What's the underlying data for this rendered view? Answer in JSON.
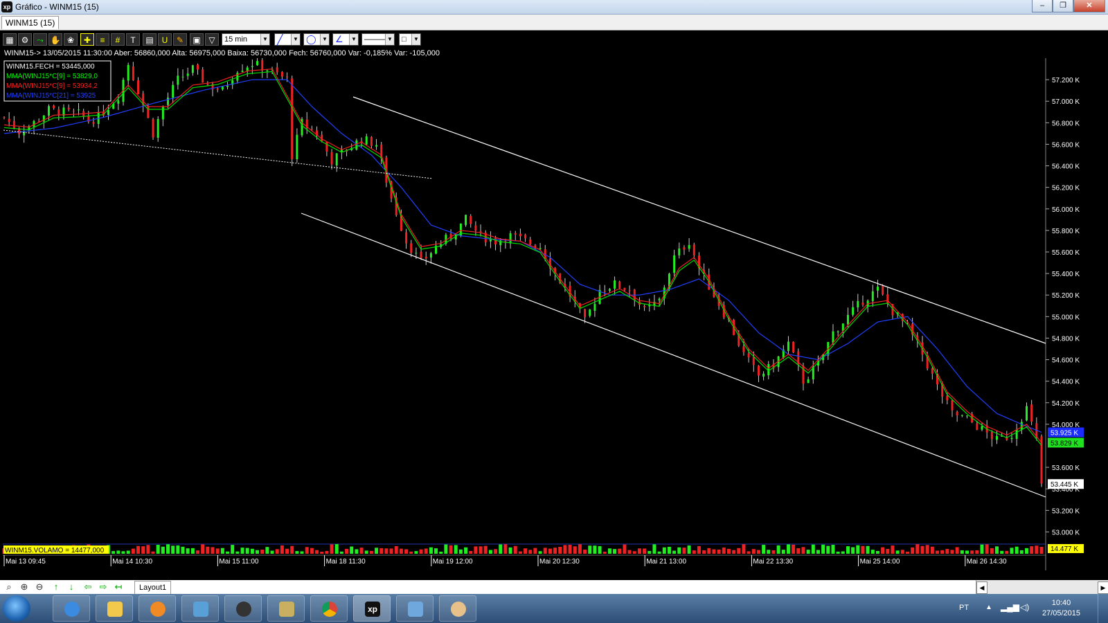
{
  "window": {
    "title": "Gráfico - WINM15 (15)",
    "app_icon": "xp",
    "controls": [
      "minimize-icon",
      "restore-icon",
      "close-icon"
    ]
  },
  "doc_tab": {
    "label": "WINM15 (15)"
  },
  "toolbar": {
    "interval": "15 min",
    "icons": [
      "chart-type-icon",
      "gear-icon",
      "indicator-icon",
      "hand-pan-icon",
      "zoom-fit-icon",
      "crosshair-icon",
      "horizontal-lines-icon",
      "grid-lines-icon",
      "text-tool-icon",
      "calculator-icon",
      "magnet-icon",
      "paint-icon",
      "clipboard-icon",
      "filter-icon"
    ],
    "draw_tools": [
      "line-tool-icon",
      "ellipse-tool-icon",
      "fibonacci-tool-icon",
      "line-style-icon",
      "color-box-icon"
    ]
  },
  "infobar": {
    "text": "WINM15-> 13/05/2015 11:30:00 Aber: 56860,000 Alta: 56975,000 Baixa: 56730,000 Fech: 56760,000 Var: -0,185% Var: -105,000"
  },
  "legend": [
    {
      "text": "WINM15.FECH = 53445,000",
      "color": "#ffffff"
    },
    {
      "text": "MMA(WINJ15*C[9] = 53829,0",
      "color": "#00ff00"
    },
    {
      "text": "MMA(WINJ15*C[9] = 53934,2",
      "color": "#ff2020"
    },
    {
      "text": "MMA(WINJ15*C[21] = 53925",
      "color": "#2040ff"
    }
  ],
  "volume_legend": {
    "text": "WINM15.VOLAMO = 14477,000"
  },
  "chart_data": {
    "type": "candlestick",
    "y_ticks": [
      "57.200 K",
      "57.000 K",
      "56.800 K",
      "56.600 K",
      "56.400 K",
      "56.200 K",
      "56.000 K",
      "55.800 K",
      "55.600 K",
      "55.400 K",
      "55.200 K",
      "55.000 K",
      "54.800 K",
      "54.600 K",
      "54.400 K",
      "54.200 K",
      "54.000 K",
      "53.600 K",
      "53.400 K",
      "53.200 K",
      "53.000 K"
    ],
    "ylim": [
      52900,
      57400
    ],
    "x_labels": [
      "Mai 13 09:45",
      "Mai 14 10:30",
      "Mai 15 11:00",
      "Mai 18 11:30",
      "Mai 19 12:00",
      "Mai 20 12:30",
      "Mai 21 13:00",
      "Mai 22 13:30",
      "Mai 25 14:00",
      "Mai 26 14:30"
    ],
    "price_path": [
      [
        0,
        56850
      ],
      [
        3,
        56720
      ],
      [
        6,
        56800
      ],
      [
        9,
        56920
      ],
      [
        12,
        56900
      ],
      [
        15,
        56880
      ],
      [
        17,
        56820
      ],
      [
        19,
        56850
      ],
      [
        21,
        56950
      ],
      [
        23,
        57050
      ],
      [
        25,
        57350
      ],
      [
        27,
        57100
      ],
      [
        30,
        56700
      ],
      [
        32,
        56950
      ],
      [
        35,
        57200
      ],
      [
        38,
        57300
      ],
      [
        41,
        57150
      ],
      [
        44,
        57100
      ],
      [
        47,
        57300
      ],
      [
        50,
        57350
      ],
      [
        53,
        57300
      ],
      [
        57,
        57200
      ],
      [
        58,
        56500
      ],
      [
        60,
        56800
      ],
      [
        63,
        56700
      ],
      [
        66,
        56450
      ],
      [
        69,
        56550
      ],
      [
        72,
        56650
      ],
      [
        75,
        56600
      ],
      [
        78,
        56100
      ],
      [
        81,
        55700
      ],
      [
        84,
        55500
      ],
      [
        87,
        55650
      ],
      [
        90,
        55750
      ],
      [
        93,
        55900
      ],
      [
        96,
        55750
      ],
      [
        99,
        55700
      ],
      [
        102,
        55750
      ],
      [
        105,
        55700
      ],
      [
        108,
        55650
      ],
      [
        111,
        55400
      ],
      [
        114,
        55200
      ],
      [
        117,
        54950
      ],
      [
        120,
        55250
      ],
      [
        123,
        55300
      ],
      [
        126,
        55250
      ],
      [
        129,
        55050
      ],
      [
        132,
        55150
      ],
      [
        135,
        55550
      ],
      [
        138,
        55700
      ],
      [
        140,
        55450
      ],
      [
        143,
        55200
      ],
      [
        146,
        54950
      ],
      [
        149,
        54650
      ],
      [
        152,
        54450
      ],
      [
        155,
        54550
      ],
      [
        158,
        54750
      ],
      [
        161,
        54400
      ],
      [
        164,
        54550
      ],
      [
        167,
        54850
      ],
      [
        170,
        55000
      ],
      [
        173,
        55150
      ],
      [
        176,
        55250
      ],
      [
        179,
        55050
      ],
      [
        182,
        54900
      ],
      [
        185,
        54650
      ],
      [
        188,
        54350
      ],
      [
        191,
        54100
      ],
      [
        194,
        54050
      ],
      [
        197,
        53950
      ],
      [
        200,
        53850
      ],
      [
        203,
        53900
      ],
      [
        206,
        54150
      ],
      [
        208,
        53850
      ],
      [
        209,
        53445
      ]
    ],
    "sma9": [
      [
        0,
        56780
      ],
      [
        5,
        56760
      ],
      [
        10,
        56870
      ],
      [
        15,
        56880
      ],
      [
        20,
        56900
      ],
      [
        25,
        57150
      ],
      [
        29,
        56950
      ],
      [
        33,
        56950
      ],
      [
        38,
        57150
      ],
      [
        43,
        57180
      ],
      [
        49,
        57280
      ],
      [
        54,
        57300
      ],
      [
        57,
        57050
      ],
      [
        60,
        56800
      ],
      [
        64,
        56650
      ],
      [
        68,
        56550
      ],
      [
        72,
        56620
      ],
      [
        76,
        56500
      ],
      [
        80,
        55950
      ],
      [
        84,
        55650
      ],
      [
        88,
        55680
      ],
      [
        92,
        55800
      ],
      [
        96,
        55780
      ],
      [
        100,
        55720
      ],
      [
        104,
        55700
      ],
      [
        108,
        55620
      ],
      [
        112,
        55350
      ],
      [
        116,
        55100
      ],
      [
        120,
        55180
      ],
      [
        124,
        55260
      ],
      [
        128,
        55150
      ],
      [
        132,
        55120
      ],
      [
        136,
        55450
      ],
      [
        139,
        55550
      ],
      [
        142,
        55350
      ],
      [
        146,
        55000
      ],
      [
        150,
        54700
      ],
      [
        154,
        54520
      ],
      [
        158,
        54650
      ],
      [
        162,
        54500
      ],
      [
        166,
        54700
      ],
      [
        170,
        54920
      ],
      [
        174,
        55120
      ],
      [
        178,
        55150
      ],
      [
        182,
        54950
      ],
      [
        186,
        54650
      ],
      [
        190,
        54300
      ],
      [
        194,
        54120
      ],
      [
        198,
        53980
      ],
      [
        202,
        53900
      ],
      [
        206,
        54000
      ],
      [
        209,
        53829
      ]
    ],
    "sma21": [
      [
        0,
        56700
      ],
      [
        10,
        56750
      ],
      [
        20,
        56850
      ],
      [
        30,
        56980
      ],
      [
        40,
        57100
      ],
      [
        50,
        57200
      ],
      [
        57,
        57200
      ],
      [
        62,
        56950
      ],
      [
        68,
        56700
      ],
      [
        74,
        56500
      ],
      [
        80,
        56200
      ],
      [
        86,
        55850
      ],
      [
        92,
        55750
      ],
      [
        98,
        55720
      ],
      [
        104,
        55700
      ],
      [
        110,
        55550
      ],
      [
        116,
        55300
      ],
      [
        122,
        55200
      ],
      [
        128,
        55200
      ],
      [
        134,
        55250
      ],
      [
        140,
        55350
      ],
      [
        146,
        55150
      ],
      [
        152,
        54850
      ],
      [
        158,
        54650
      ],
      [
        164,
        54600
      ],
      [
        170,
        54750
      ],
      [
        176,
        54950
      ],
      [
        182,
        55000
      ],
      [
        188,
        54700
      ],
      [
        194,
        54350
      ],
      [
        200,
        54100
      ],
      [
        205,
        54000
      ],
      [
        209,
        53925
      ]
    ],
    "channel_upper": [
      [
        510,
        140
      ],
      [
        1510,
        496
      ]
    ],
    "channel_lower": [
      [
        435,
        308
      ],
      [
        1510,
        718
      ]
    ],
    "dotted_support": [
      [
        5,
        188
      ],
      [
        625,
        258
      ]
    ],
    "price_tags": [
      {
        "text": "53.925 K",
        "value": 53925,
        "bg": "#1a2cff",
        "fg": "#ffffff"
      },
      {
        "text": "53.829 K",
        "value": 53829,
        "bg": "#20e020",
        "fg": "#000000"
      },
      {
        "text": "53.445 K",
        "value": 53445,
        "bg": "#ffffff",
        "fg": "#000000"
      }
    ],
    "volume_tag": {
      "text": "14.477 K",
      "bg": "#ffff00",
      "fg": "#000000"
    }
  },
  "bottom_tools": {
    "icons": [
      "zoom-icon",
      "zoom-in-icon",
      "zoom-out-icon",
      "up-arrow-icon",
      "down-arrow-icon",
      "left-arrow-icon",
      "right-arrow-icon",
      "back-arrow-icon"
    ],
    "layout_tab": "Layout1"
  },
  "taskbar": {
    "apps": [
      "windows-start-icon",
      "internet-explorer-icon",
      "folder-icon",
      "media-player-icon",
      "network-app-icon",
      "hp-icon",
      "secure-app-icon",
      "chrome-icon",
      "xp-app-icon",
      "photo-viewer-icon",
      "paint-icon"
    ],
    "tray": {
      "lang": "PT",
      "time": "10:40",
      "date": "27/05/2015"
    }
  }
}
